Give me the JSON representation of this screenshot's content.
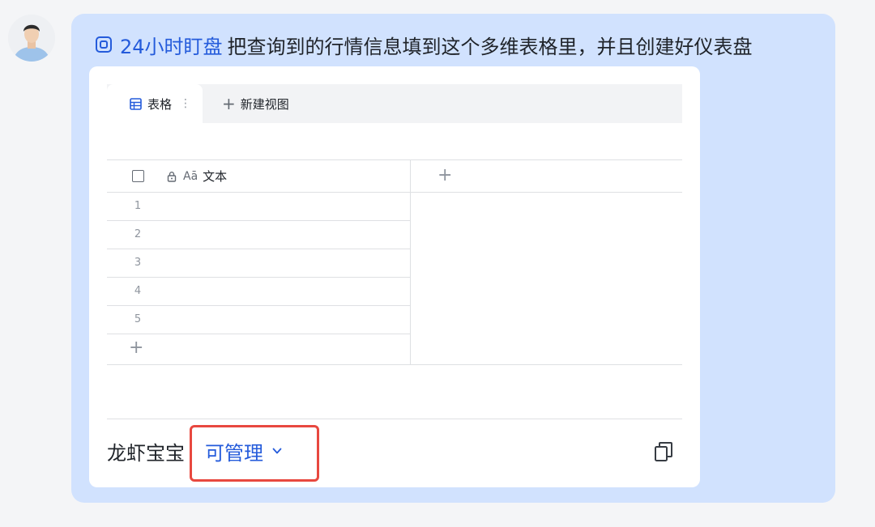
{
  "message": {
    "mention": "24小时盯盘",
    "text": "把查询到的行情信息填到这个多维表格里，并且创建好仪表盘"
  },
  "card": {
    "tabs": [
      {
        "label": "表格",
        "icon": "table-icon",
        "active": true
      }
    ],
    "new_view_label": "新建视图",
    "field": {
      "type_icon": "Aā",
      "name": "文本"
    },
    "rows": [
      "1",
      "2",
      "3",
      "4",
      "5"
    ],
    "footer": {
      "owner": "龙虾宝宝",
      "permission": "可管理"
    }
  },
  "colors": {
    "bubble": "#d1e2fe",
    "accent": "#245bdb",
    "highlight_border": "#e8483f"
  }
}
